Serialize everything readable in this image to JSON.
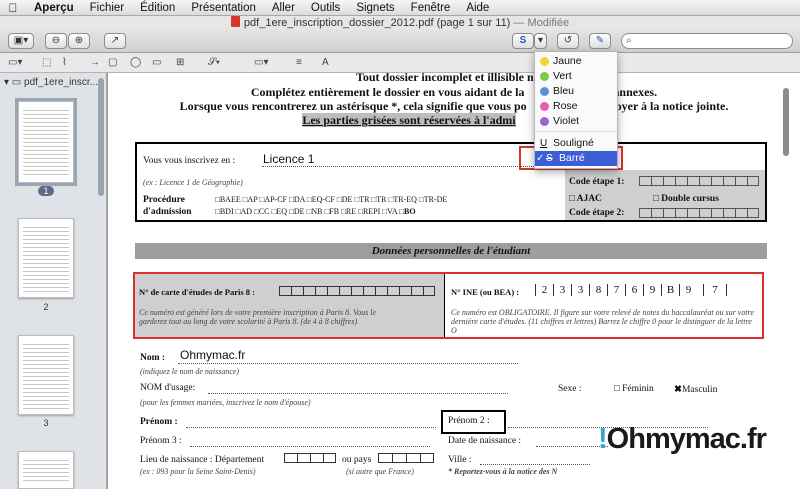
{
  "menubar": {
    "app": "Aperçu",
    "items": [
      "Fichier",
      "Édition",
      "Présentation",
      "Aller",
      "Outils",
      "Signets",
      "Fenêtre",
      "Aide"
    ]
  },
  "title": {
    "filename": "pdf_1ere_inscription_dossier_2012.pdf",
    "pageinfo": "(page 1 sur 11)",
    "modified": "— Modifiée"
  },
  "toolbar": {
    "search_icon": "search-icon"
  },
  "sidebar": {
    "title": "pdf_1ere_inscr...",
    "pages": [
      "1",
      "2",
      "3"
    ]
  },
  "menu": {
    "colors": [
      {
        "label": "Jaune",
        "color": "#f2d33a"
      },
      {
        "label": "Vert",
        "color": "#7dc94a"
      },
      {
        "label": "Bleu",
        "color": "#5b8fdc"
      },
      {
        "label": "Rose",
        "color": "#e35db0"
      },
      {
        "label": "Violet",
        "color": "#9a63d8"
      }
    ],
    "underline": "Souligné",
    "strike": "Barré",
    "check": "✓"
  },
  "doc": {
    "line0": "Tout dossier incomplet et illisible ne se",
    "line1": "Complétez entièrement le dossier en vous aidant de la",
    "line1b": "annexes.",
    "line2": "Lorsque vous rencontrerez un astérisque *, cela signifie que vous po",
    "line2b": "oyer à la notice jointe.",
    "line3": "Les parties grisées sont réservées à l'admi",
    "inscr_label": "Vous vous inscrivez en :",
    "inscr_value": "Licence 1",
    "inscr_ex": "(ex : Licence 1 de Géographie)",
    "code1": "Code étape 1:",
    "proc": "Procédure",
    "adm": "d'admission",
    "opts1": "□BAEE □AP □AP-CF □DA □EQ-CF □DE",
    "opts1b": "□TR □TR □TR-EQ □TR-DE",
    "opts2": "□BDI □AD □CC □EQ □DE □NB □FB □RE □REPI □VA",
    "opts2b": "□BO",
    "ajac": "□ AJAC",
    "double": "□ Double cursus",
    "code2": "Code étape 2:",
    "section": "Données personnelles de l'étudiant",
    "carte": "N° de carte d'études de Paris 8 :",
    "carte_note": "Ce numéro est généré lors de votre première inscription à Paris 8. Vous le garderez tout au long de votre scolarité à Paris 8. (de 4 à 8 chiffres)",
    "ine": "N° INE (ou BEA) :",
    "ine_digits": [
      "2",
      "3",
      "3",
      "8",
      "7",
      "6",
      "9",
      "B",
      "9",
      "7"
    ],
    "ine_note": "Ce numéro est OBLIGATOIRE. Il figure sur votre relevé de notes du baccalauréat ou sur votre dernière carte d'études. (11 chiffres et lettres) Barrez le chiffre 0 pour le distinguer de la lettre O",
    "nom": "Nom :",
    "nom_value": "Ohmymac.fr",
    "nom_hint": "(indiquez le nom de naissance)",
    "usage": "NOM d'usage:",
    "usage_hint": "(pour les femmes mariées, inscrivez le nom d'épouse)",
    "sexe": "Sexe :",
    "feminin": "□ Féminin",
    "masculin": "Masculin",
    "prenom": "Prénom :",
    "prenom2": "Prénom 2 :",
    "prenom3": "Prénom 3 :",
    "naissance": "Date de naissance :",
    "lieu": "Lieu de naissance : Département",
    "pays": "ou pays",
    "ville": "Ville :",
    "lieu_hint": "(ex : 093 pour la Seine Saint-Denis)",
    "pays_hint": "(si autre que France)",
    "notice": "* Reportez-vous à la notice des N"
  },
  "watermark": {
    "bang": "!",
    "text": "Ohmymac.fr"
  }
}
